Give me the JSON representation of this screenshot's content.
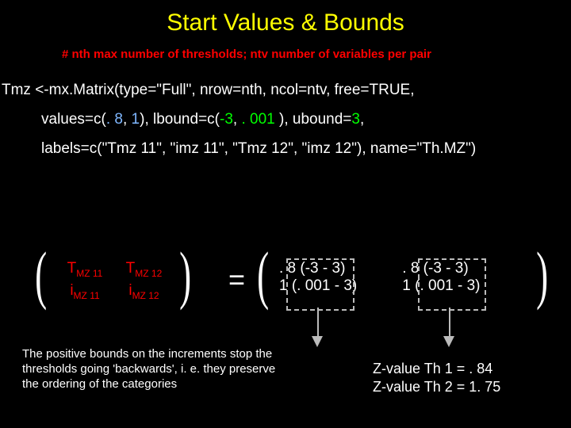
{
  "title": "Start Values & Bounds",
  "comment": "# nth max number of thresholds; ntv number of variables per pair",
  "code": {
    "line1_a": "Tmz <-mx.Matrix(type=\"Full\", nrow=nth, ncol=ntv, free=TRUE,",
    "line2_a": "values=c(",
    "line2_b": ". 8",
    "line2_c": ", ",
    "line2_d": "1",
    "line2_e": "), lbound=c(",
    "line2_f": "-3",
    "line2_g": ", ",
    "line2_h": ". 001",
    "line2_i": " ), ubound=",
    "line2_j": "3",
    "line2_k": ",",
    "line3": "labels=c(\"Tmz 11\", \"imz 11\", \"Tmz 12\", \"imz 12\"), name=\"Th.MZ\")"
  },
  "matrix": {
    "r1c1_t": "T",
    "r1c1_s": "MZ 11",
    "r1c2_t": "T",
    "r1c2_s": "MZ 12",
    "r2c1_t": "i",
    "r2c1_s": "MZ 11",
    "r2c2_t": "i",
    "r2c2_s": "MZ 12"
  },
  "eq": "=",
  "valuemat": {
    "r1c1": ". 8 (-3   - 3)",
    "r1c2": ". 8 (-3   -  3)",
    "r2c1": " 1 (. 001 - 3)",
    "r2c2": " 1 (. 001 - 3)"
  },
  "note": "The positive bounds on the increments stop the thresholds going 'backwards', i. e. they preserve the ordering of the categories",
  "zvals": {
    "z1": "Z-value Th 1 = . 84",
    "z2": "Z-value Th 2 = 1. 75"
  }
}
